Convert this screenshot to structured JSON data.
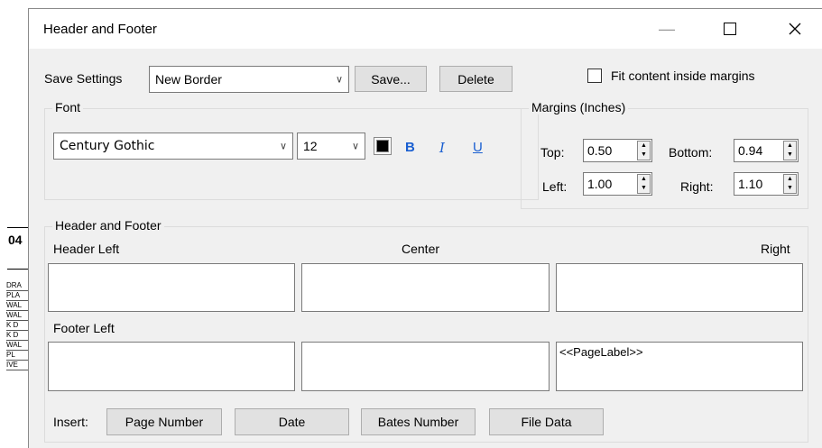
{
  "background": {
    "label": "04",
    "stack": [
      "DRA",
      "PLA",
      "WAL",
      "WAL",
      "K D",
      "K D",
      "WAL",
      "PL",
      "IVE"
    ]
  },
  "window": {
    "title": "Header and Footer",
    "minimize_icon": "minimize-icon",
    "maximize_icon": "maximize-icon",
    "close_icon": "close-icon"
  },
  "settings": {
    "label": "Save Settings",
    "selected": "New Border",
    "save_label": "Save...",
    "delete_label": "Delete",
    "fit_label": "Fit content inside margins",
    "fit_checked": false
  },
  "font": {
    "legend": "Font",
    "family": "Century Gothic",
    "size": "12",
    "color": "#000000",
    "bold": "B",
    "italic": "I",
    "underline": "U"
  },
  "margins": {
    "legend": "Margins (Inches)",
    "top_label": "Top:",
    "top": "0.50",
    "bottom_label": "Bottom:",
    "bottom": "0.94",
    "left_label": "Left:",
    "left": "1.00",
    "right_label": "Right:",
    "right": "1.10"
  },
  "header_footer": {
    "legend": "Header and Footer",
    "header_left_label": "Header Left",
    "center_label": "Center",
    "right_label": "Right",
    "footer_left_label": "Footer Left",
    "header_left": "",
    "header_center": "",
    "header_right": "",
    "footer_left": "",
    "footer_center": "",
    "footer_right": "<<PageLabel>>"
  },
  "insert": {
    "label": "Insert:",
    "buttons": [
      "Page Number",
      "Date",
      "Bates Number",
      "File Data"
    ]
  }
}
